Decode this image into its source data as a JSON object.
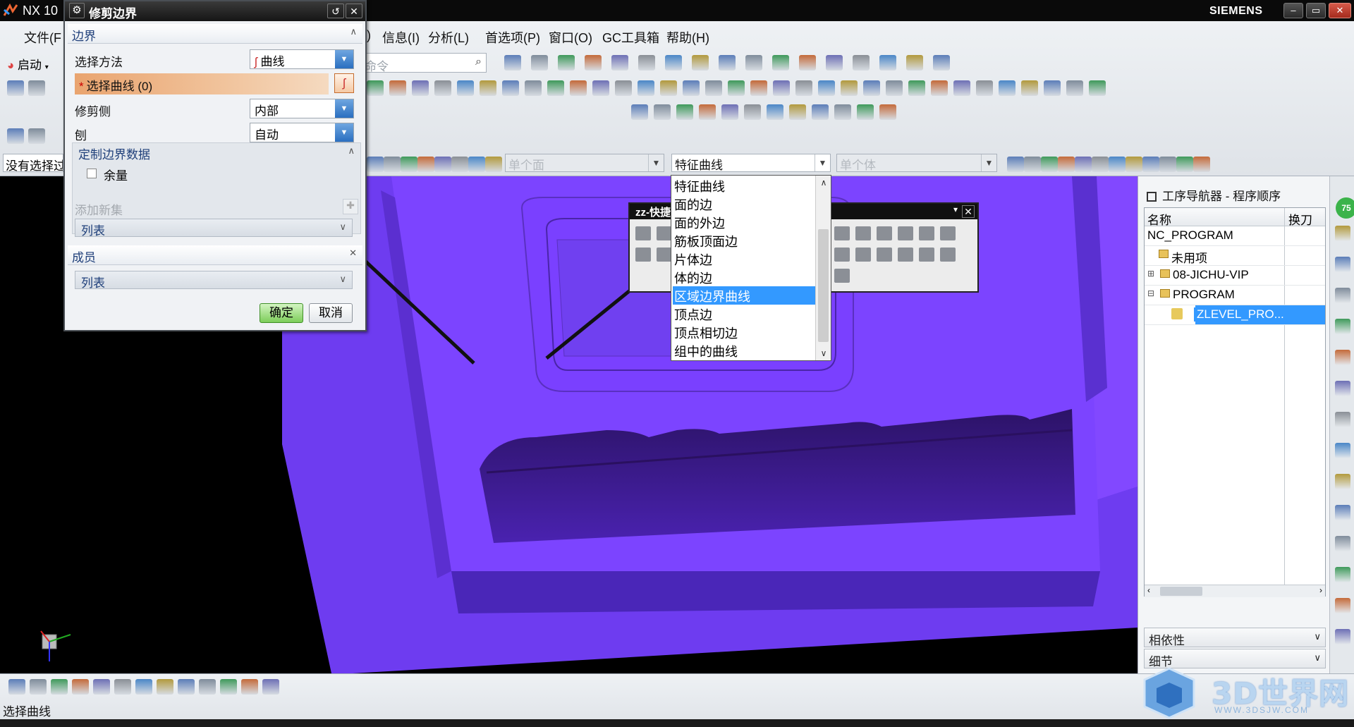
{
  "window": {
    "app_title": "NX 10",
    "brand": "SIEMENS",
    "minimize": "–",
    "restore": "▭",
    "close": "✕"
  },
  "menu": {
    "file": "文件(F",
    "frag": ")",
    "info": "信息(I)",
    "analysis": "分析(L)",
    "prefs": "首选项(P)",
    "window": "窗口(O)",
    "gc": "GC工具箱",
    "help": "帮助(H)"
  },
  "toolbar": {
    "start": "启动",
    "search_placeholder": "命令"
  },
  "selection_bar": {
    "no_selection": "没有选择过滤器",
    "face_rule": "单个面",
    "curve_rule": "特征曲线",
    "body_rule": "单个体"
  },
  "dialog": {
    "title": "修剪边界",
    "group_boundary": "边界",
    "select_method_label": "选择方法",
    "select_method_value": "曲线",
    "select_curve": "选择曲线 (0)",
    "required_mark": "*",
    "trim_side_label": "修剪侧",
    "trim_side_value": "内部",
    "plane_label": "刨",
    "plane_value": "自动",
    "custom_group": "定制边界数据",
    "stock_label": "余量",
    "add_new_set": "添加新集",
    "list_label": "列表",
    "members_group": "成员",
    "members_list": "列表",
    "ok": "确定",
    "cancel": "取消"
  },
  "quickpick": {
    "title": "zz-快捷"
  },
  "curve_rule_dropdown": {
    "items": [
      "特征曲线",
      "面的边",
      "面的外边",
      "筋板顶面边",
      "片体边",
      "体的边",
      "区域边界曲线",
      "顶点边",
      "顶点相切边",
      "组中的曲线"
    ],
    "selected_index": 6
  },
  "navigator": {
    "title": "工序导航器 - 程序顺序",
    "col_name": "名称",
    "col_tool": "换刀",
    "rows": [
      {
        "label": "NC_PROGRAM"
      },
      {
        "label": "未用项"
      },
      {
        "label": "08-JICHU-VIP"
      },
      {
        "label": "PROGRAM"
      },
      {
        "label": "ZLEVEL_PRO..."
      }
    ],
    "dependencies": "相依性",
    "details": "细节"
  },
  "status": {
    "prompt": "选择曲线"
  },
  "watermark": {
    "text": "3D世界网",
    "url": "WWW.3DSJW.COM"
  },
  "badge_number": "75",
  "colors": {
    "model_purple": "#7e44ff",
    "model_dark": "#3c1f8a",
    "highlight": "#3399ff",
    "ok_green": "#7dcd5a"
  }
}
